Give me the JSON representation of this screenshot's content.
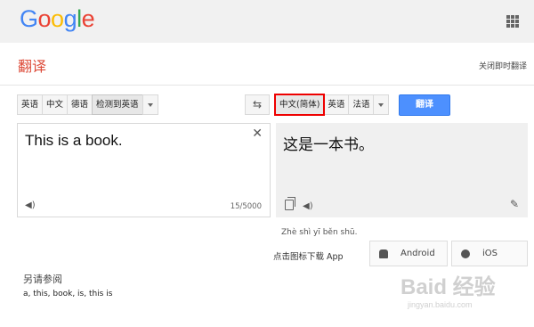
{
  "header": {
    "logo_letters": [
      {
        "char": "G",
        "color": "#4285f4"
      },
      {
        "char": "o",
        "color": "#ea4335"
      },
      {
        "char": "o",
        "color": "#fbbc05"
      },
      {
        "char": "g",
        "color": "#4285f4"
      },
      {
        "char": "l",
        "color": "#34a853"
      },
      {
        "char": "e",
        "color": "#ea4335"
      }
    ],
    "apps_icon": "grid-icon"
  },
  "subheader": {
    "title": "翻译",
    "instant_toggle": "关闭即时翻译"
  },
  "source_langs": {
    "items": [
      "英语",
      "中文",
      "德语",
      "检测到英语"
    ],
    "active_index": 3
  },
  "target_langs": {
    "items": [
      "中文(简体)",
      "英语",
      "法语"
    ],
    "active_index": 0
  },
  "swap_icon": "swap-arrows-icon",
  "translate_button": "翻译",
  "source": {
    "text": "This is a book.",
    "char_count": "15/5000"
  },
  "target": {
    "text": "这是一本书。",
    "pinyin": "Zhè shì yī běn shū."
  },
  "apps": {
    "prompt": "点击图标下载 App",
    "android": "Android",
    "ios": "iOS"
  },
  "see_also": {
    "title": "另请参阅",
    "items": "a, this, book, is, this is"
  },
  "watermark": {
    "main": "Baid 经验",
    "sub": "jingyan.baidu.com"
  },
  "colors": {
    "accent": "#4d90fe",
    "title": "#dd4b39",
    "highlight": "#e00000"
  }
}
